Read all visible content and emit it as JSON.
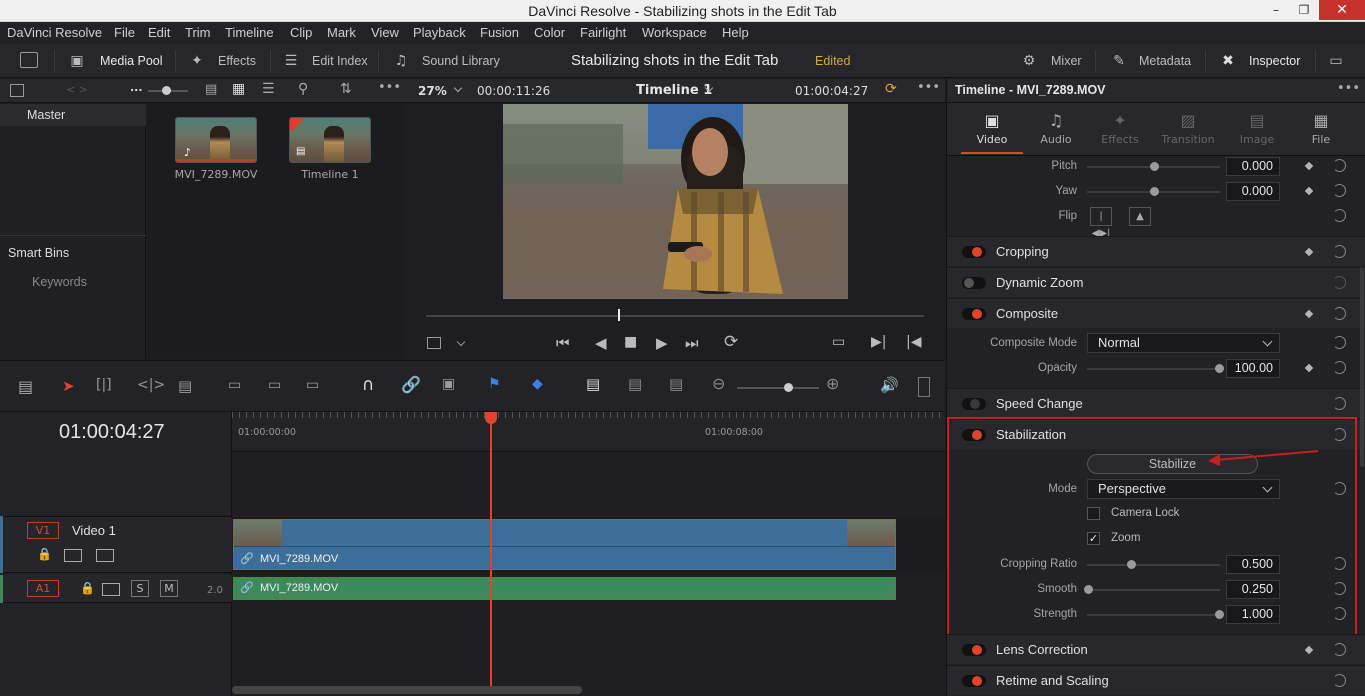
{
  "window": {
    "title": "DaVinci Resolve - Stabilizing shots in the Edit Tab"
  },
  "menu": [
    "DaVinci Resolve",
    "File",
    "Edit",
    "Trim",
    "Timeline",
    "Clip",
    "Mark",
    "View",
    "Playback",
    "Fusion",
    "Color",
    "Fairlight",
    "Workspace",
    "Help"
  ],
  "toolbar": {
    "media_pool": "Media Pool",
    "effects": "Effects",
    "edit_index": "Edit Index",
    "sound_library": "Sound Library",
    "project_title": "Stabilizing shots in the Edit Tab",
    "status": "Edited",
    "mixer": "Mixer",
    "metadata": "Metadata",
    "inspector": "Inspector"
  },
  "subbar": {
    "zoom": "27%",
    "timecode_left": "00:00:11:26",
    "timeline_name": "Timeline 1",
    "timecode_right": "01:00:04:27",
    "more": "..."
  },
  "bins": {
    "master": "Master",
    "smart_bins": "Smart Bins",
    "keywords": "Keywords"
  },
  "pool_items": [
    {
      "label": "MVI_7289.MOV"
    },
    {
      "label": "Timeline 1"
    }
  ],
  "timeline": {
    "timecode": "01:00:04:27",
    "ruler": [
      "01:00:00:00",
      "01:00:08:00"
    ],
    "video_track": {
      "id": "V1",
      "name": "Video 1",
      "clip": "MVI_7289.MOV"
    },
    "audio_track": {
      "id": "A1",
      "s": "S",
      "m": "M",
      "level": "2.0",
      "clip": "MVI_7289.MOV"
    }
  },
  "inspector": {
    "header": "Timeline - MVI_7289.MOV",
    "tabs": [
      "Video",
      "Audio",
      "Effects",
      "Transition",
      "Image",
      "File"
    ],
    "pitch": {
      "label": "Pitch",
      "value": "0.000"
    },
    "yaw": {
      "label": "Yaw",
      "value": "0.000"
    },
    "flip": {
      "label": "Flip"
    },
    "sections": {
      "cropping": "Cropping",
      "dynamic_zoom": "Dynamic Zoom",
      "composite": "Composite",
      "speed_change": "Speed Change",
      "stabilization": "Stabilization",
      "lens_correction": "Lens Correction",
      "retime": "Retime and Scaling"
    },
    "composite_mode": {
      "label": "Composite Mode",
      "value": "Normal"
    },
    "opacity": {
      "label": "Opacity",
      "value": "100.00"
    },
    "stabilize_button": "Stabilize",
    "mode": {
      "label": "Mode",
      "value": "Perspective"
    },
    "camera_lock": {
      "label": "Camera Lock",
      "checked": false
    },
    "zoom": {
      "label": "Zoom",
      "checked": true
    },
    "cropping_ratio": {
      "label": "Cropping Ratio",
      "value": "0.500"
    },
    "smooth": {
      "label": "Smooth",
      "value": "0.250"
    },
    "strength": {
      "label": "Strength",
      "value": "1.000"
    }
  },
  "colors": {
    "accent": "#e0452c",
    "highlight_box": "#c81e1e",
    "video_clip": "#3c6e9a",
    "audio_clip": "#3a8a5a"
  }
}
